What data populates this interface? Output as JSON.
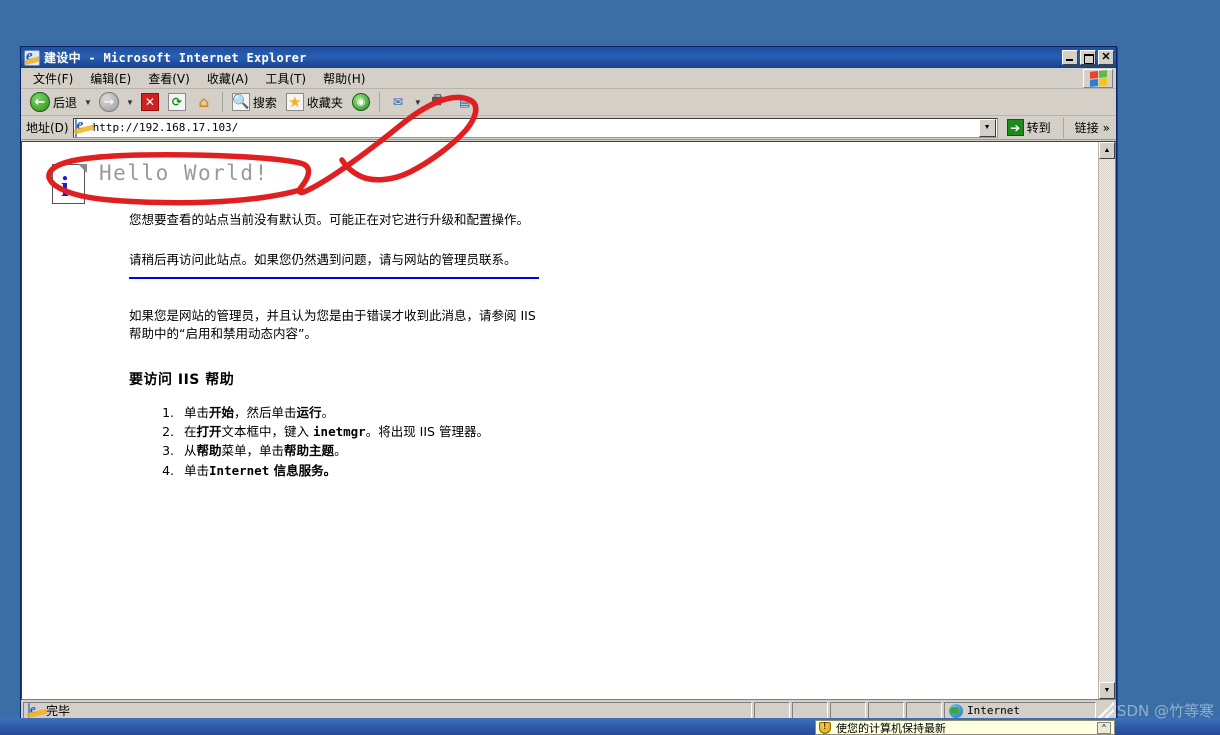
{
  "window": {
    "title": "建设中 - Microsoft Internet Explorer",
    "minimize_label": "",
    "maximize_label": "",
    "close_label": "✕"
  },
  "menu": {
    "items": [
      {
        "label": "文件(F)",
        "name": "menu-file"
      },
      {
        "label": "编辑(E)",
        "name": "menu-edit"
      },
      {
        "label": "查看(V)",
        "name": "menu-view"
      },
      {
        "label": "收藏(A)",
        "name": "menu-favorites"
      },
      {
        "label": "工具(T)",
        "name": "menu-tools"
      },
      {
        "label": "帮助(H)",
        "name": "menu-help"
      }
    ]
  },
  "toolbar": {
    "back_label": "后退",
    "back_icon": "back-arrow-icon",
    "forward_icon": "forward-arrow-icon",
    "stop_icon": "stop-icon",
    "stop_glyph": "✕",
    "refresh_icon": "refresh-icon",
    "refresh_glyph": "⟳",
    "home_icon": "home-icon",
    "home_glyph": "⌂",
    "search_label": "搜索",
    "search_icon": "search-icon",
    "search_glyph": "🔍",
    "favorites_label": "收藏夹",
    "favorites_icon": "star-icon",
    "favorites_glyph": "★",
    "media_icon": "media-icon",
    "media_glyph": "◉",
    "mail_icon": "mail-icon",
    "mail_glyph": "✉",
    "print_icon": "print-icon",
    "print_glyph": "🖶",
    "edit_icon": "edit-icon",
    "edit_glyph": "▤",
    "dropdown_glyph": "▼"
  },
  "address": {
    "label": "地址(D)",
    "value": "http://192.168.17.103/",
    "placeholder": "",
    "dropdown_glyph": "▼",
    "go_label": "转到",
    "go_glyph": "➔",
    "links_label": "链接",
    "links_chevron": "»"
  },
  "page": {
    "heading": "Hello World!",
    "icon_letter": "i",
    "paragraph1": "您想要查看的站点当前没有默认页。可能正在对它进行升级和配置操作。",
    "paragraph2": "请稍后再访问此站点。如果您仍然遇到问题，请与网站的管理员联系。",
    "paragraph3_a": "如果您是网站的管理员，并且认为您是由于错误才收到此消息，请参阅 IIS",
    "paragraph3_b": "帮助中的“启用和禁用动态内容”。",
    "subheading": "要访问 IIS 帮助",
    "steps": [
      {
        "prefix": "单击",
        "bold1": "开始",
        "mid": "，然后单击",
        "bold2": "运行",
        "suffix": "。"
      },
      {
        "prefix": "在",
        "bold1": "打开",
        "mid": "文本框中，键入 ",
        "mono": "inetmgr",
        "suffix": "。将出现 IIS 管理器。"
      },
      {
        "prefix": "从",
        "bold1": "帮助",
        "mid": "菜单，单击",
        "bold2": "帮助主题",
        "suffix": "。"
      },
      {
        "prefix": "单击",
        "mono": "Internet",
        "suffix": " 信息服务。"
      }
    ]
  },
  "scrollbar": {
    "up_glyph": "▲",
    "down_glyph": "▼"
  },
  "status": {
    "text": "完毕",
    "zone": "Internet",
    "zone_icon": "globe-icon"
  },
  "balloon": {
    "text": "使您的计算机保持最新",
    "icon": "shield-warning-icon",
    "close_glyph": "^"
  },
  "watermark": "CSDN @竹等寒",
  "colors": {
    "titlebar": "#15428b",
    "chrome": "#d4d0c8",
    "desktop": "#3a6ea5",
    "annotation": "#e02020",
    "heading": "#9a9a9a",
    "hr": "#0000ee"
  }
}
